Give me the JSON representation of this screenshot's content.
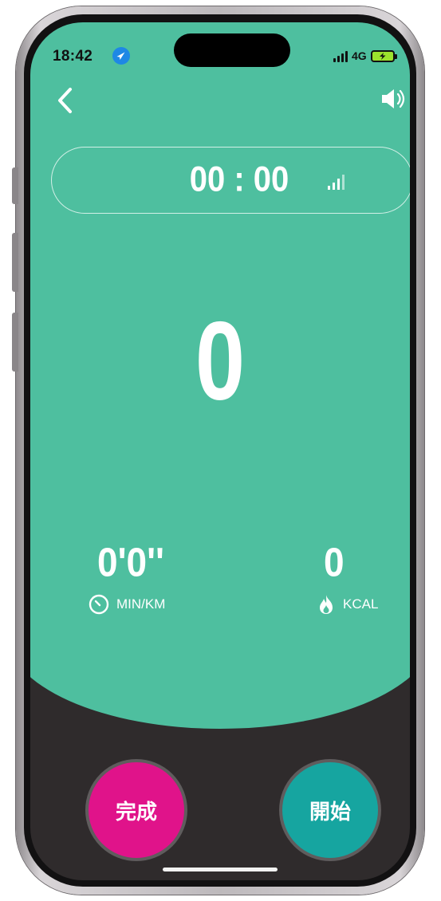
{
  "status_bar": {
    "time": "18:42",
    "network": "4G"
  },
  "header": {
    "back_icon": "chevron-left-icon",
    "sound_icon": "speaker-icon"
  },
  "timer": {
    "elapsed": "00 : 00",
    "gps_signal_icon": "gps-signal-icon"
  },
  "distance": {
    "value": "0"
  },
  "stats": {
    "pace": {
      "value": "0'0''",
      "label": "MIN/KM",
      "icon": "clock-icon"
    },
    "calories": {
      "value": "0",
      "label": "KCAL",
      "icon": "flame-icon"
    }
  },
  "actions": {
    "finish_label": "完成",
    "start_label": "開始"
  },
  "colors": {
    "primary_green": "#4ebf9f",
    "dark_background": "#2f2b2c",
    "finish_button": "#e0138a",
    "start_button": "#16a5a0"
  }
}
